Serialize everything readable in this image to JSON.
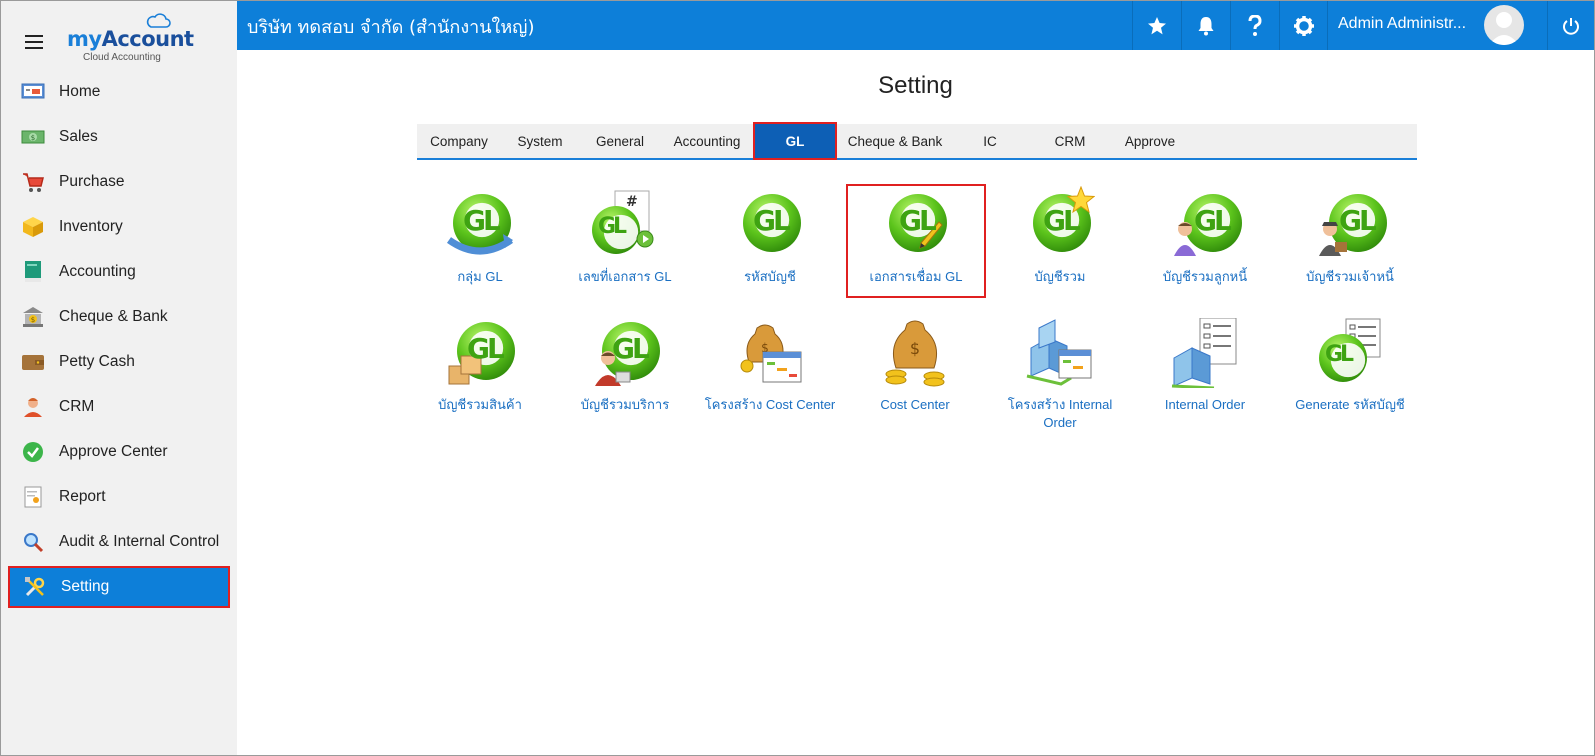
{
  "brand": {
    "name_my": "my",
    "name_account": "Account",
    "subtitle": "Cloud Accounting"
  },
  "header": {
    "company": "บริษัท ทดสอบ จำกัด (สำนักงานใหญ่)",
    "user_name": "Admin Administr...",
    "icons": [
      "star-icon",
      "bell-icon",
      "help-icon",
      "gear-icon",
      "power-icon"
    ]
  },
  "sidebar": {
    "items": [
      {
        "label": "Home",
        "icon": "home-icon"
      },
      {
        "label": "Sales",
        "icon": "cash-icon"
      },
      {
        "label": "Purchase",
        "icon": "cart-icon"
      },
      {
        "label": "Inventory",
        "icon": "box-icon"
      },
      {
        "label": "Accounting",
        "icon": "book-icon"
      },
      {
        "label": "Cheque & Bank",
        "icon": "bank-icon"
      },
      {
        "label": "Petty Cash",
        "icon": "wallet-icon"
      },
      {
        "label": "CRM",
        "icon": "people-icon"
      },
      {
        "label": "Approve Center",
        "icon": "check-icon"
      },
      {
        "label": "Report",
        "icon": "report-icon"
      },
      {
        "label": "Audit & Internal Control",
        "icon": "magnifier-icon"
      },
      {
        "label": "Setting",
        "icon": "tools-icon",
        "active": true
      }
    ]
  },
  "main": {
    "title": "Setting",
    "tabs": [
      {
        "label": "Company"
      },
      {
        "label": "System"
      },
      {
        "label": "General"
      },
      {
        "label": "Accounting"
      },
      {
        "label": "GL",
        "active": true
      },
      {
        "label": "Cheque & Bank"
      },
      {
        "label": "IC"
      },
      {
        "label": "CRM"
      },
      {
        "label": "Approve"
      }
    ],
    "tiles": [
      {
        "label": "กลุ่ม GL",
        "icon": "gl-group-icon"
      },
      {
        "label": "เลขที่เอกสาร GL",
        "icon": "gl-document-number-icon"
      },
      {
        "label": "รหัสบัญชี",
        "icon": "gl-account-code-icon"
      },
      {
        "label": "เอกสารเชื่อม GL",
        "icon": "gl-link-document-icon",
        "highlight": true
      },
      {
        "label": "บัญชีรวม",
        "icon": "gl-control-account-icon"
      },
      {
        "label": "บัญชีรวมลูกหนี้",
        "icon": "gl-debtor-account-icon"
      },
      {
        "label": "บัญชีรวมเจ้าหนี้",
        "icon": "gl-creditor-account-icon"
      },
      {
        "label": "บัญชีรวมสินค้า",
        "icon": "gl-inventory-account-icon"
      },
      {
        "label": "บัญชีรวมบริการ",
        "icon": "gl-service-account-icon"
      },
      {
        "label": "โครงสร้าง Cost Center",
        "icon": "cost-center-structure-icon"
      },
      {
        "label": "Cost Center",
        "icon": "cost-center-icon"
      },
      {
        "label": "โครงสร้าง Internal Order",
        "icon": "internal-order-structure-icon"
      },
      {
        "label": "Internal Order",
        "icon": "internal-order-icon"
      },
      {
        "label": "Generate รหัสบัญชี",
        "icon": "generate-account-code-icon"
      }
    ]
  },
  "colors": {
    "primary": "#0d7fd9",
    "highlight": "#e02020",
    "link": "#1a6fc2",
    "sidebar_bg": "#f1f1f1"
  }
}
